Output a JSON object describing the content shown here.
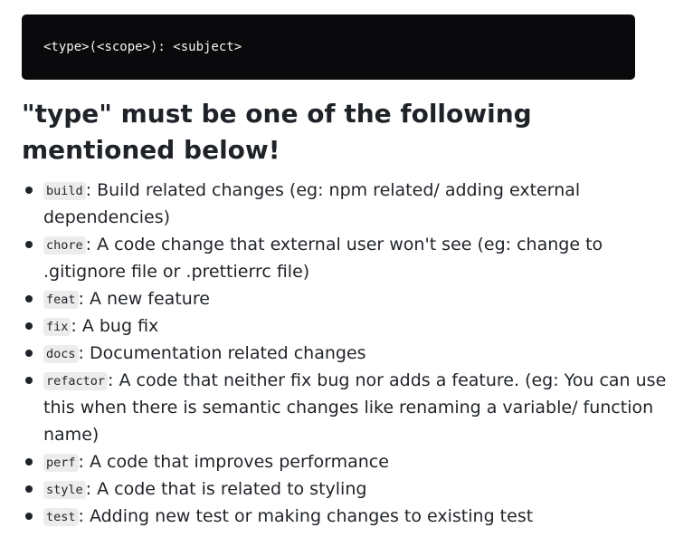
{
  "code_block": {
    "text": "<type>(<scope>): <subject>",
    "background": "#0a0a0c"
  },
  "heading": "\"type\" must be one of the following mentioned below!",
  "types": [
    {
      "name": "build",
      "description": ": Build related changes (eg: npm related/ adding external dependencies)"
    },
    {
      "name": "chore",
      "description": ": A code change that external user won't see (eg: change to .gitignore file or .prettierrc file)"
    },
    {
      "name": "feat",
      "description": ": A new feature"
    },
    {
      "name": "fix",
      "description": ": A bug fix"
    },
    {
      "name": "docs",
      "description": ": Documentation related changes"
    },
    {
      "name": "refactor",
      "description": ": A code that neither fix bug nor adds a feature. (eg: You can use this when there is semantic changes like renaming a variable/ function name)"
    },
    {
      "name": "perf",
      "description": ": A code that improves performance"
    },
    {
      "name": "style",
      "description": ": A code that is related to styling"
    },
    {
      "name": "test",
      "description": ": Adding new test or making changes to existing test"
    }
  ]
}
